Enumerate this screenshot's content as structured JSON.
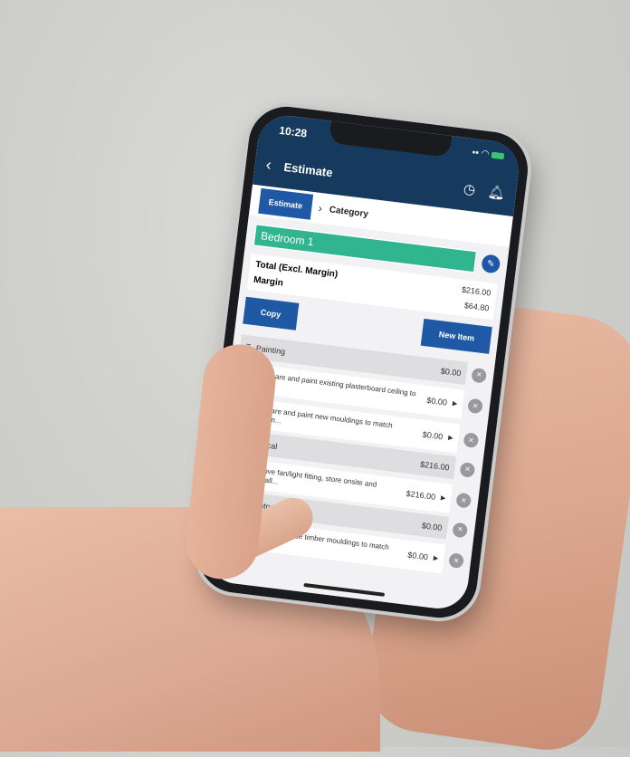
{
  "phone": {
    "status": {
      "time": "10:28"
    },
    "nav": {
      "back": "‹",
      "title": "Estimate",
      "history_icon": "clock-icon",
      "bell_icon": "bell-icon"
    },
    "breadcrumb": {
      "estimate": "Estimate",
      "separator": "›",
      "category": "Category"
    },
    "room": {
      "name": "Bedroom 1",
      "edit_icon": "pencil-icon"
    },
    "totals": {
      "total_label": "Total (Excl. Margin)",
      "total_value": "$216.00",
      "margin_label": "Margin",
      "margin_value": "$64.80"
    },
    "actions": {
      "copy": "Copy",
      "new_item": "New Item"
    },
    "categories": [
      {
        "name": "Painting",
        "total": "$0.00",
        "items": [
          {
            "desc": "Prepare and paint existing plasterboard ceiling to ...",
            "price": "$0.00"
          },
          {
            "desc": "Prepare and paint new mouldings to match existin...",
            "price": "$0.00"
          }
        ]
      },
      {
        "name": "Electrical",
        "total": "$216.00",
        "items": [
          {
            "desc": "Remove fan/light fitting, store onsite and reinstall...",
            "price": "$216.00"
          }
        ]
      },
      {
        "name": "Carpentry",
        "total": "$0.00",
        "items": [
          {
            "desc": "Supply and replace timber mouldings to match existi...",
            "price": "$0.00"
          }
        ]
      }
    ]
  }
}
